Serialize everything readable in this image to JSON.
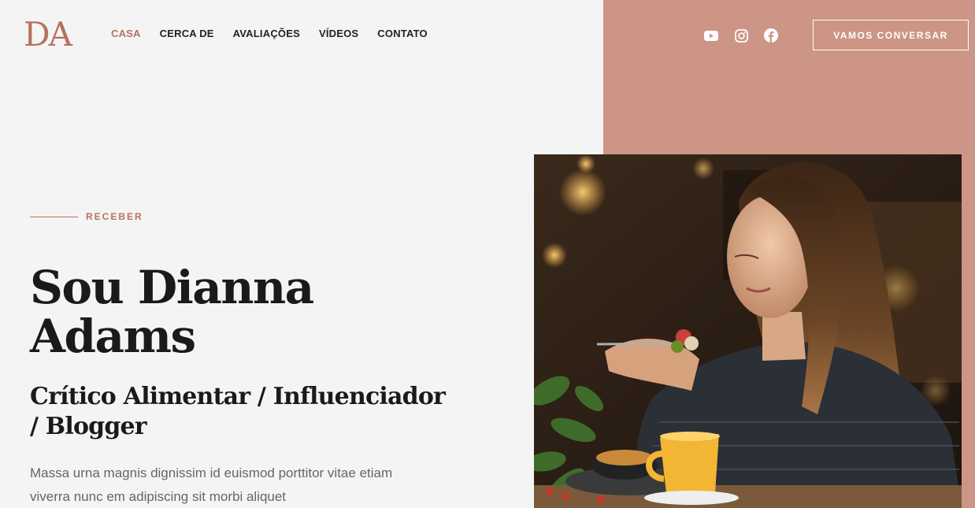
{
  "logo": {
    "text": "DA"
  },
  "nav": {
    "items": [
      {
        "label": "CASA",
        "active": true
      },
      {
        "label": "CERCA DE"
      },
      {
        "label": "AVALIAÇÕES"
      },
      {
        "label": "VÍDEOS"
      },
      {
        "label": "CONTATO"
      }
    ]
  },
  "socials": [
    "youtube-icon",
    "instagram-icon",
    "facebook-icon"
  ],
  "cta": {
    "label": "VAMOS CONVERSAR"
  },
  "hero": {
    "eyebrow": "RECEBER",
    "title_line1": "Sou Dianna",
    "title_line2": "Adams",
    "subtitle": "Crítico Alimentar / Influenciador / Blogger",
    "body": "Massa urna magnis dignissim id euismod porttitor vitae etiam viverra nunc em adipiscing sit morbi aliquet"
  },
  "colors": {
    "accent": "#b8715c",
    "panel": "#cc9585",
    "background": "#f4f4f4"
  }
}
